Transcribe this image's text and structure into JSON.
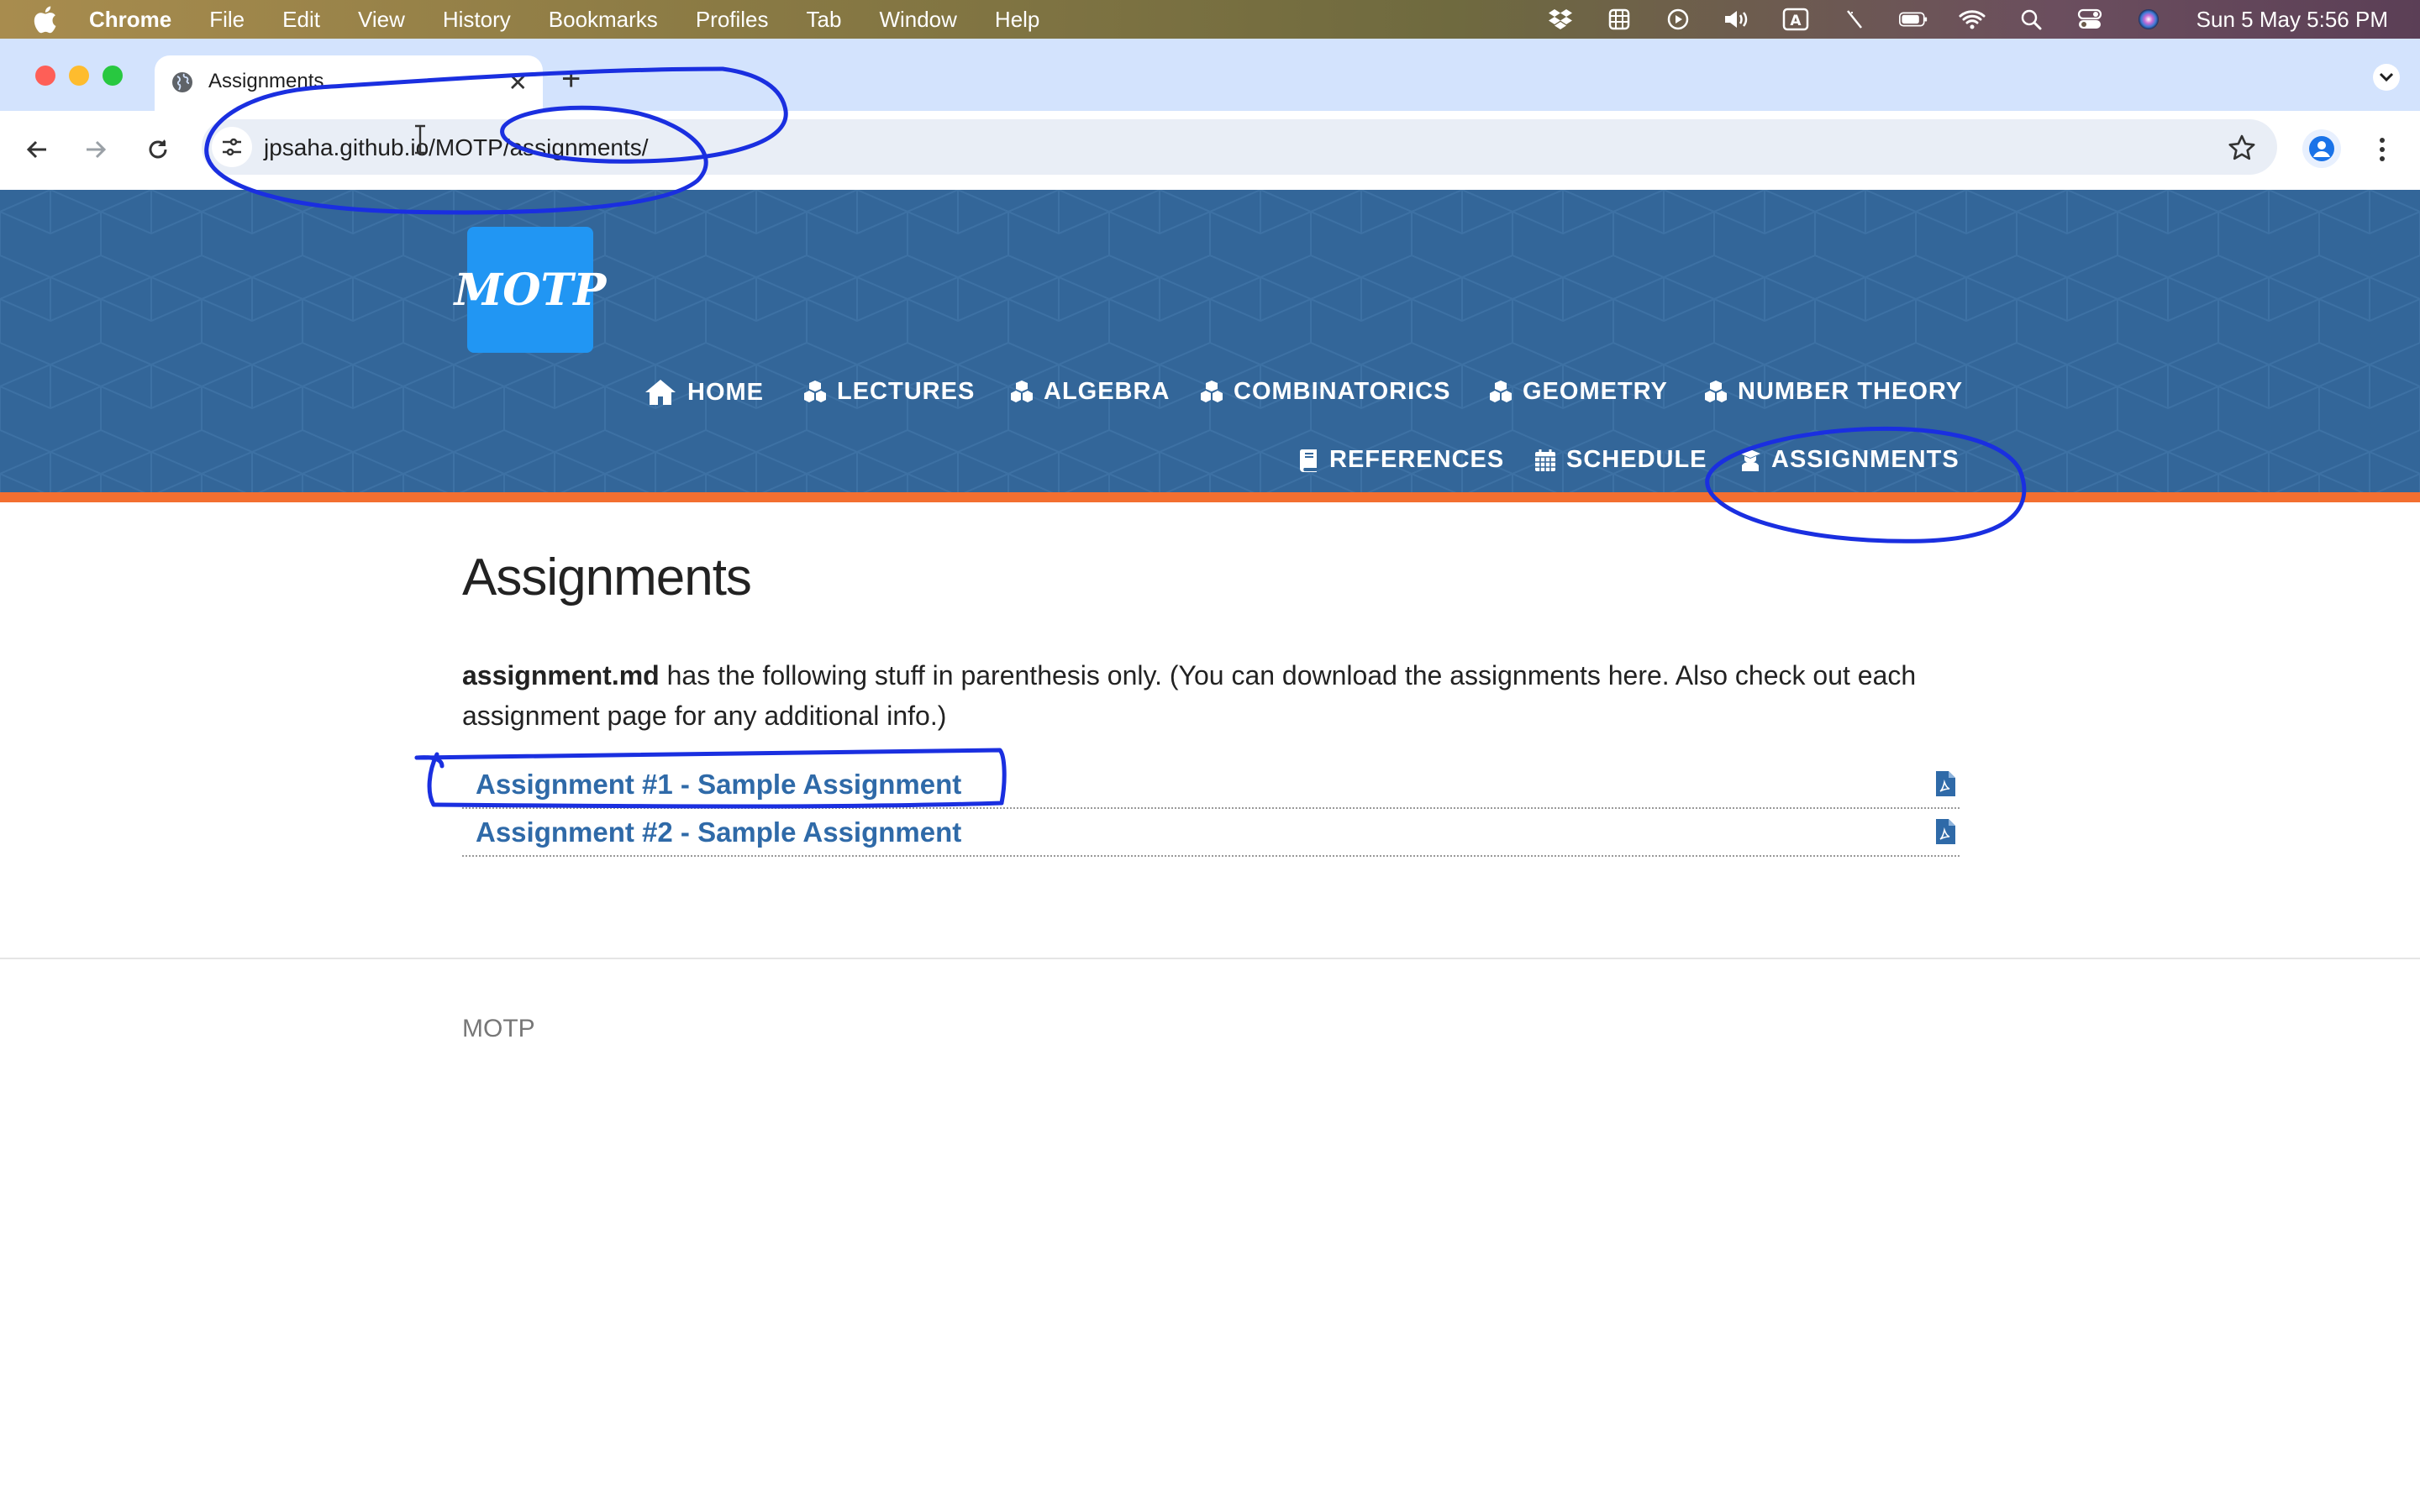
{
  "menubar": {
    "app_name": "Chrome",
    "menus": [
      "File",
      "Edit",
      "View",
      "History",
      "Bookmarks",
      "Profiles",
      "Tab",
      "Window",
      "Help"
    ],
    "clock": "Sun 5 May  5:56 PM"
  },
  "browser": {
    "tab_title": "Assignments",
    "url": "jpsaha.github.io/MOTP/assignments/"
  },
  "site": {
    "logo_text": "MOTP",
    "nav_row1": [
      "HOME",
      "LECTURES",
      "ALGEBRA",
      "COMBINATORICS",
      "GEOMETRY",
      "NUMBER THEORY"
    ],
    "nav_row2": [
      "REFERENCES",
      "SCHEDULE",
      "ASSIGNMENTS"
    ]
  },
  "content": {
    "title": "Assignments",
    "intro_bold": "assignment.md",
    "intro_rest": " has the following stuff in parenthesis only. (You can download the assignments here. Also check out each assignment page for any additional info.)",
    "assignments": [
      {
        "label": "Assignment #1 - Sample Assignment"
      },
      {
        "label": "Assignment #2 - Sample Assignment"
      }
    ]
  },
  "footer": {
    "text": "MOTP"
  },
  "colors": {
    "header_blue": "#336699",
    "accent_orange": "#f36f30",
    "link_blue": "#2f6aa8",
    "logo_blue": "#2196f3",
    "annotation_ink": "#1a2fe0"
  }
}
